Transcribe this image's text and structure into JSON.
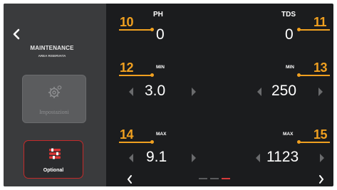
{
  "sidebar": {
    "title": "MAINTENANCE",
    "subtitle": "AREA RISERVATA",
    "tile_disabled_label": "Impostazioni",
    "tile_active_label": "Optional",
    "icons": {
      "back": "chevron-left-icon",
      "disabled": "gear-icon",
      "active": "settings-sliders-icon"
    }
  },
  "main": {
    "ph": {
      "label": "PH",
      "value": "0"
    },
    "tds": {
      "label": "TDS",
      "value": "0"
    },
    "ph_min": {
      "label": "MIN",
      "value": "3.0"
    },
    "tds_min": {
      "label": "MIN",
      "value": "250"
    },
    "ph_max": {
      "label": "MAX",
      "value": "9.1"
    },
    "tds_max": {
      "label": "MAX",
      "value": "1123"
    }
  },
  "callouts": [
    "10",
    "11",
    "12",
    "13",
    "14",
    "15"
  ],
  "pagination": {
    "pages": 3,
    "active": 3
  },
  "colors": {
    "accent": "#f0a020",
    "active_border": "#c42a2a",
    "active_dot": "#d63a3a"
  }
}
